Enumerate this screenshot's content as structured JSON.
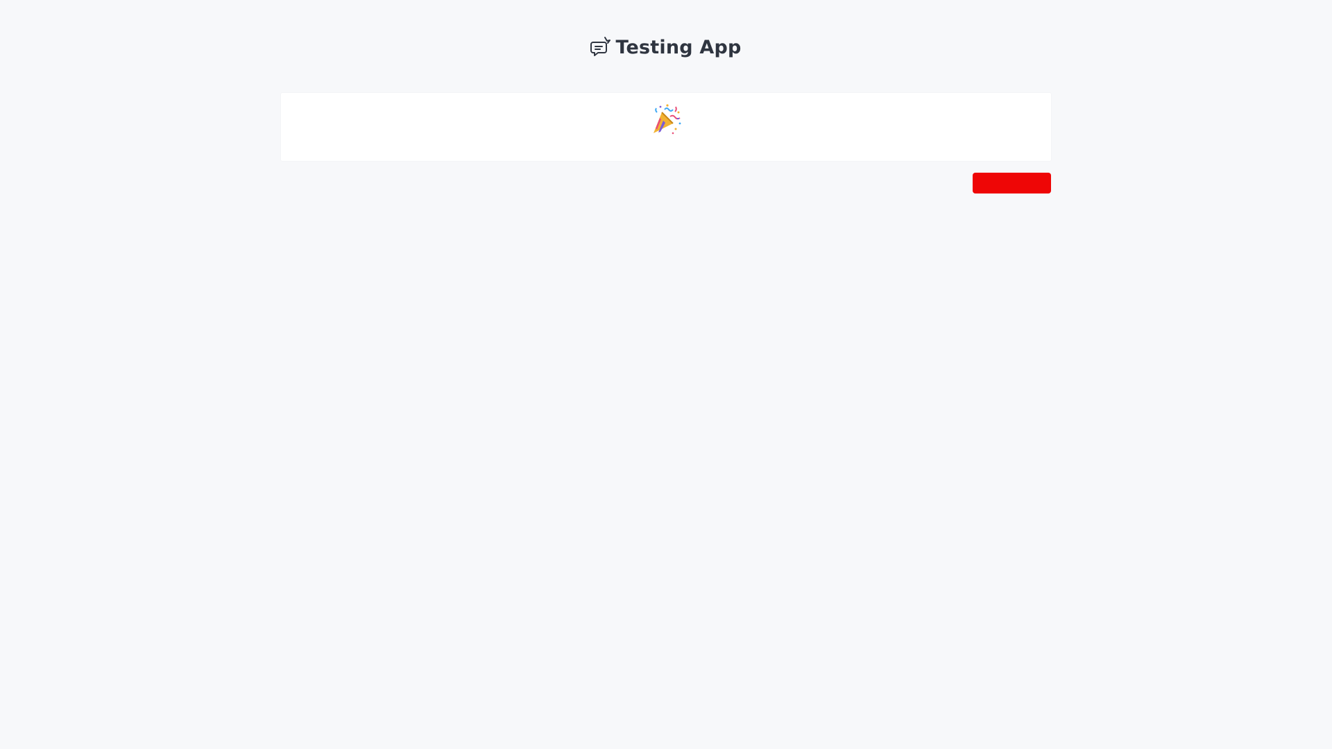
{
  "header": {
    "logo_icon": "chat-bubble-icon",
    "title": "Testing App"
  },
  "card": {
    "icon": "party-popper-icon"
  },
  "action_button": {
    "label": "",
    "color": "#ee0606"
  },
  "colors": {
    "background": "#f7f8fa",
    "card_background": "#ffffff",
    "title_text": "#2f3540"
  }
}
